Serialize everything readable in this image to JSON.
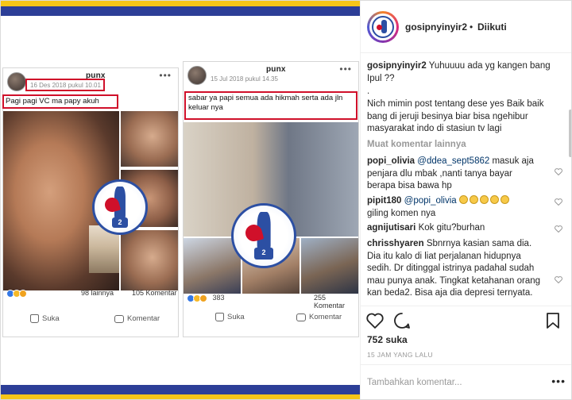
{
  "post": {
    "card1": {
      "name": "punx",
      "date": "16 Des 2018 pukul 10.01",
      "caption": "Pagi pagi VC ma papy akuh",
      "likes_more": "98 lainnya",
      "comments": "105 Komentar",
      "like_label": "Suka",
      "comment_label": "Komentar",
      "watermark_number": "2"
    },
    "card2": {
      "name": "punx",
      "date": "15 Jul 2018 pukul 14.35",
      "caption": "sabar ya papi semua ada hikmah serta ada jln keluar nya",
      "reactions_count": "383",
      "comments": "255 Komentar",
      "like_label": "Suka",
      "comment_label": "Komentar",
      "watermark_number": "2"
    }
  },
  "sidebar": {
    "username": "gosipnyinyir2",
    "separator": "•",
    "follow_status": "Diikuti",
    "caption_user": "gosipnyinyir2",
    "caption_text": "Yuhuuuu ada yg kangen bang Ipul ??",
    "caption_dot": ".",
    "caption_body": "Nich mimin post tentang dese yes Baik baik bang di jeruji besinya biar bisa ngehibur masyarakat indo di stasiun tv lagi",
    "load_more": "Muat komentar lainnya",
    "comments": [
      {
        "user": "popi_olivia",
        "mention": "@ddea_sept5862",
        "text": " masuk aja penjara dlu mbak ,nanti tanya bayar berapa bisa bawa hp"
      },
      {
        "user": "pipit180",
        "mention": "@popi_olivia",
        "text": "giling komen nya"
      },
      {
        "user": "agnijutisari",
        "mention": "",
        "text": "Kok gitu?burhan"
      },
      {
        "user": "chrisshyaren",
        "mention": "",
        "text": "Sbnrnya kasian sama dia. Dia itu kalo di liat perjalanan hidupnya sedih. Dr ditinggal istrinya padahal sudah mau punya anak. Tingkat ketahanan orang kan beda2. Bisa aja dia depresi ternyata. Kenapa semua"
      }
    ],
    "likes": "752 suka",
    "time_ago": "15 JAM YANG LALU",
    "add_comment_placeholder": "Tambahkan komentar...",
    "more_dots": "•••"
  },
  "colors": {
    "stripe_yellow": "#f5c518",
    "stripe_blue": "#2c3e97",
    "highlight_red": "#d0102a",
    "ig_link": "#003569"
  }
}
